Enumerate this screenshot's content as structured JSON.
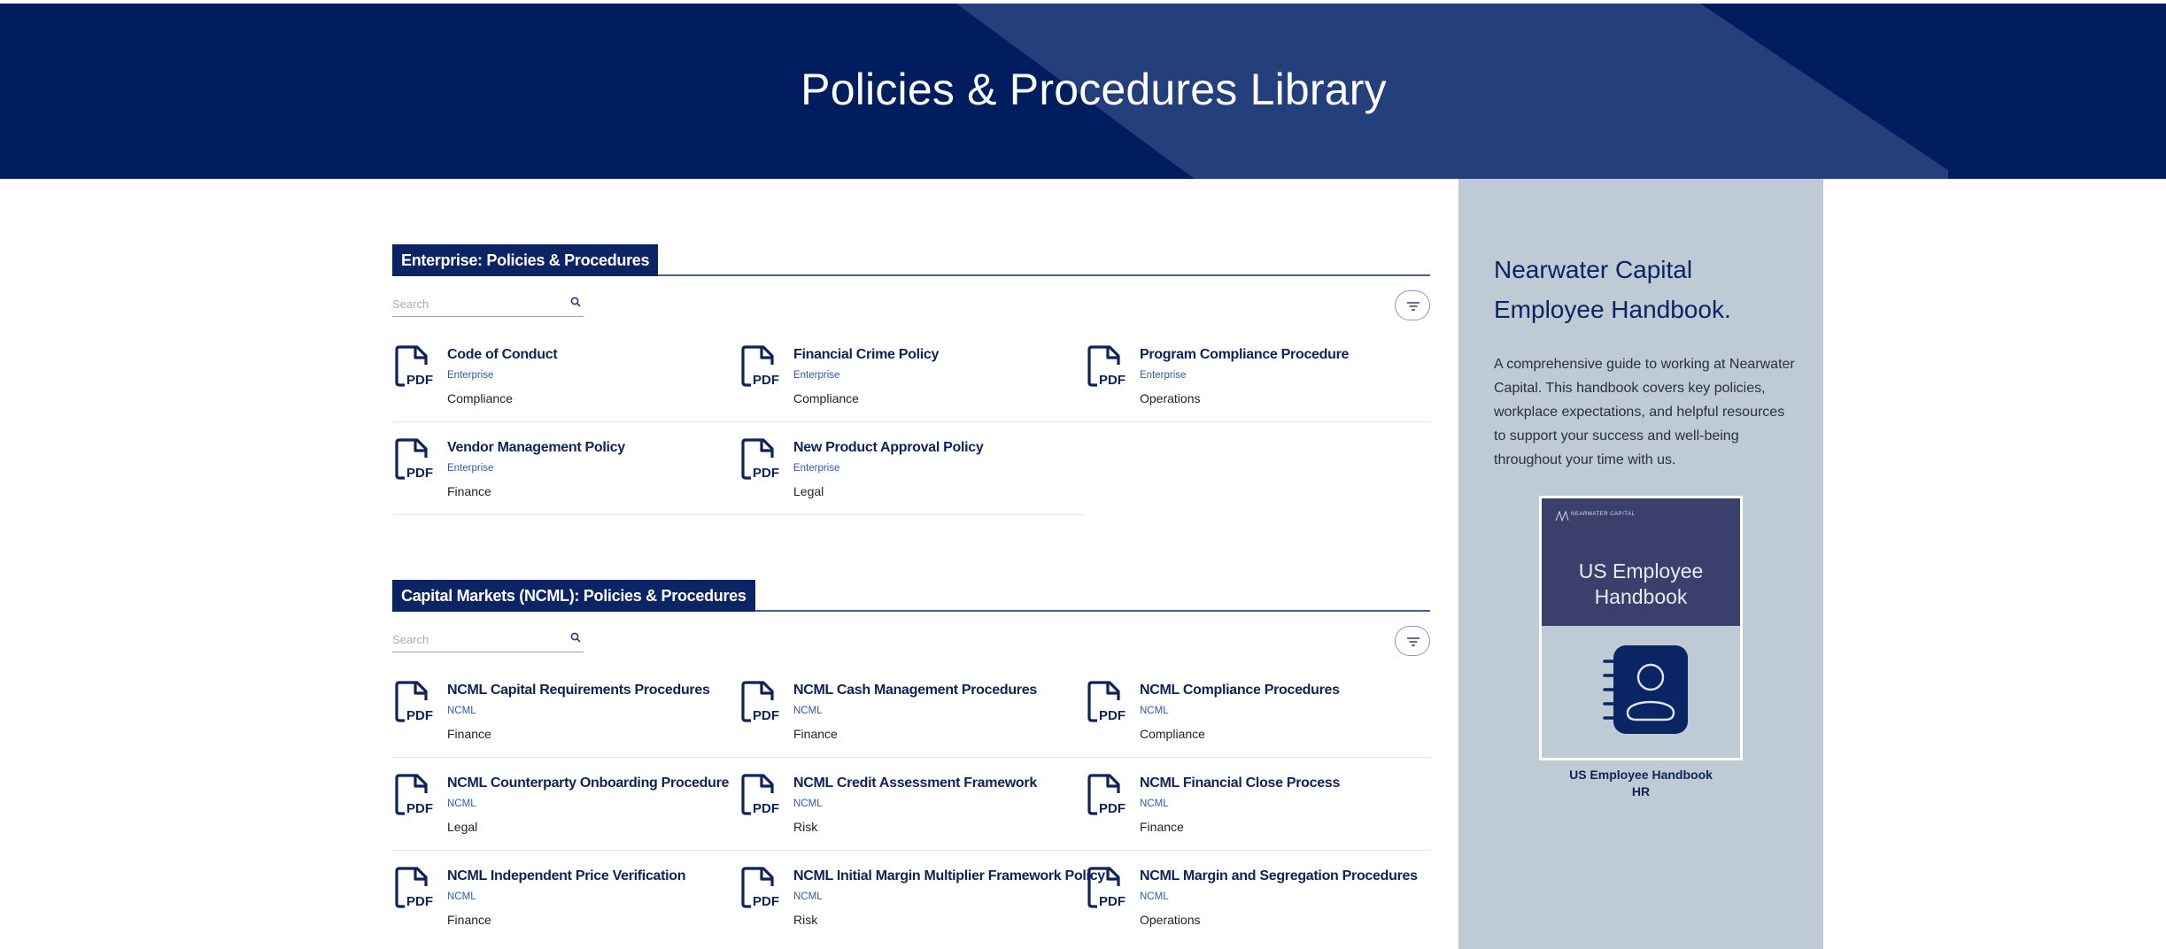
{
  "header": {
    "title": "Policies & Procedures Library"
  },
  "colors": {
    "header_bg": "#001e5f",
    "accent": "#0b2463",
    "sidebar_bg": "#bfcbd4",
    "tag_blue": "#2f57b8"
  },
  "sections": [
    {
      "title": "Enterprise: Policies & Procedures",
      "search_placeholder": "Search",
      "items": [
        {
          "title": "Code of Conduct",
          "tag": "Enterprise",
          "category": "Compliance",
          "icon": "pdf-icon"
        },
        {
          "title": "Financial Crime Policy",
          "tag": "Enterprise",
          "category": "Compliance",
          "icon": "pdf-icon"
        },
        {
          "title": "Program Compliance Procedure",
          "tag": "Enterprise",
          "category": "Operations",
          "icon": "pdf-icon"
        },
        {
          "title": "Vendor Management Policy",
          "tag": "Enterprise",
          "category": "Finance",
          "icon": "pdf-icon"
        },
        {
          "title": "New Product Approval Policy",
          "tag": "Enterprise",
          "category": "Legal",
          "icon": "pdf-icon"
        }
      ]
    },
    {
      "title": "Capital Markets (NCML): Policies & Procedures",
      "search_placeholder": "Search",
      "items": [
        {
          "title": "NCML Capital Requirements Procedures",
          "tag": "NCML",
          "category": "Finance",
          "icon": "pdf-icon"
        },
        {
          "title": "NCML Cash Management Procedures",
          "tag": "NCML",
          "category": "Finance",
          "icon": "pdf-icon"
        },
        {
          "title": "NCML Compliance Procedures",
          "tag": "NCML",
          "category": "Compliance",
          "icon": "pdf-icon"
        },
        {
          "title": "NCML Counterparty Onboarding Procedure",
          "tag": "NCML",
          "category": "Legal",
          "icon": "pdf-icon"
        },
        {
          "title": "NCML Credit Assessment Framework",
          "tag": "NCML",
          "category": "Risk",
          "icon": "pdf-icon"
        },
        {
          "title": "NCML Financial Close Process",
          "tag": "NCML",
          "category": "Finance",
          "icon": "pdf-icon"
        },
        {
          "title": "NCML Independent Price Verification",
          "tag": "NCML",
          "category": "Finance",
          "icon": "pdf-icon"
        },
        {
          "title": "NCML Initial Margin Multiplier Framework Policy",
          "tag": "NCML",
          "category": "Risk",
          "icon": "pdf-icon"
        },
        {
          "title": "NCML Margin and Segregation Procedures",
          "tag": "NCML",
          "category": "Operations",
          "icon": "pdf-icon"
        }
      ]
    }
  ],
  "sidebar": {
    "title": "Nearwater Capital Employee Handbook.",
    "description": "A comprehensive guide to working at Nearwater Capital. This handbook covers key policies, workplace expectations, and helpful resources to support your success and well-being throughout your time with us.",
    "book": {
      "logo_text": "NEARWATER CAPITAL",
      "cover_title": "US Employee Handbook",
      "caption_title": "US Employee Handbook",
      "caption_subtitle": "HR",
      "icon": "handbook-person-icon"
    }
  }
}
